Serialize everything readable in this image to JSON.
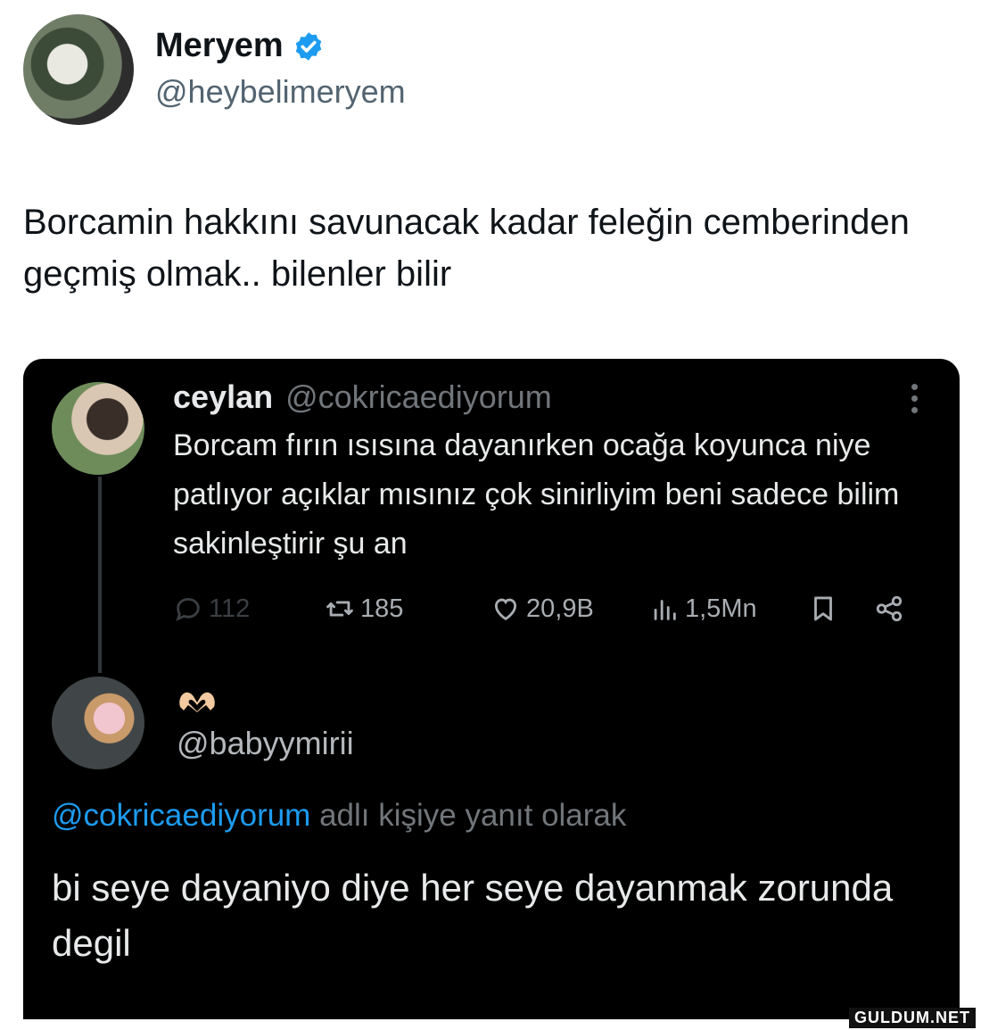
{
  "tweet": {
    "author_name": "Meryem",
    "author_handle": "@heybelimeryem",
    "text": "Borcamin hakkını savunacak kadar feleğin cemberinden geçmiş olmak.. bilenler bilir"
  },
  "quoted": {
    "name": "ceylan",
    "handle": "@cokricaediyorum",
    "text": "Borcam fırın ısısına dayanırken ocağa koyunca niye patlıyor açıklar mısınız çok sinirliyim beni sadece bilim sakinleştirir şu an",
    "stats": {
      "replies": "112",
      "retweets": "185",
      "likes": "20,9B",
      "views": "1,5Mn"
    }
  },
  "reply": {
    "handle": "@babyymirii",
    "mention": "@cokricaediyorum",
    "reply_suffix": " adlı kişiye yanıt olarak",
    "text": "bi seye dayaniyo diye her seye dayanmak zorunda degil"
  },
  "watermark": "GULDUM.NET",
  "colors": {
    "accent": "#1d9bf0",
    "dark_bg": "#000000",
    "muted": "#71767b"
  },
  "icons": [
    "verified-icon",
    "more-icon",
    "reply-icon",
    "retweet-icon",
    "like-icon",
    "views-icon",
    "bookmark-icon",
    "share-icon",
    "heart-hands-icon"
  ]
}
